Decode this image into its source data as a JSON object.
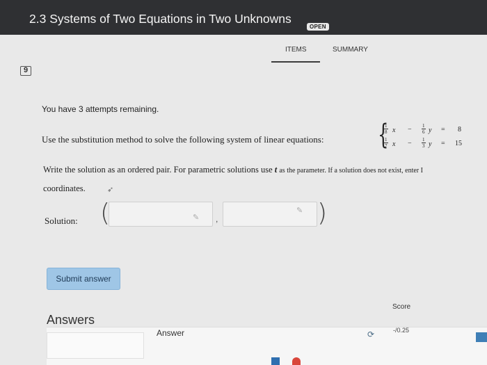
{
  "header": {
    "title": "2.3 Systems of Two Equations in Two Unknowns",
    "badge": "OPEN"
  },
  "tabs": [
    {
      "label": "ITEMS",
      "active": true
    },
    {
      "label": "SUMMARY",
      "active": false
    }
  ],
  "question": {
    "number": "9",
    "attempts": "You have 3 attempts remaining.",
    "prompt": "Use the substitution method to solve the following system of linear equations:",
    "system": {
      "eq1": {
        "a_num": "1",
        "a_den": "8",
        "x": "x",
        "op": "−",
        "b_num": "1",
        "b_den": "6",
        "y": "y",
        "eq": "=",
        "rhs": "8"
      },
      "eq2": {
        "a_num": "1",
        "a_den": "7",
        "x": "x",
        "op": "−",
        "b_num": "1",
        "b_den": "3",
        "y": "y",
        "eq": "=",
        "rhs": "15"
      }
    },
    "instructions_main": "Write the solution as an ordered pair. For parametric solutions use",
    "instructions_param": "t",
    "instructions_rest": "as the parameter. If a solution does not exist, enter I",
    "instructions_line2": "coordinates.",
    "solution_label": "Solution:",
    "paren_open": "(",
    "paren_close": ")",
    "comma": ",",
    "solution_x": "",
    "solution_y": ""
  },
  "submit_label": "Submit answer",
  "answers": {
    "title": "Answers",
    "col_answer": "Answer",
    "col_score": "Score",
    "score_value": "-/0.25"
  },
  "colors": {
    "header_bg": "#2f3033",
    "submit_bg": "#9fc6e6",
    "page_bg": "#e9e9e9"
  }
}
